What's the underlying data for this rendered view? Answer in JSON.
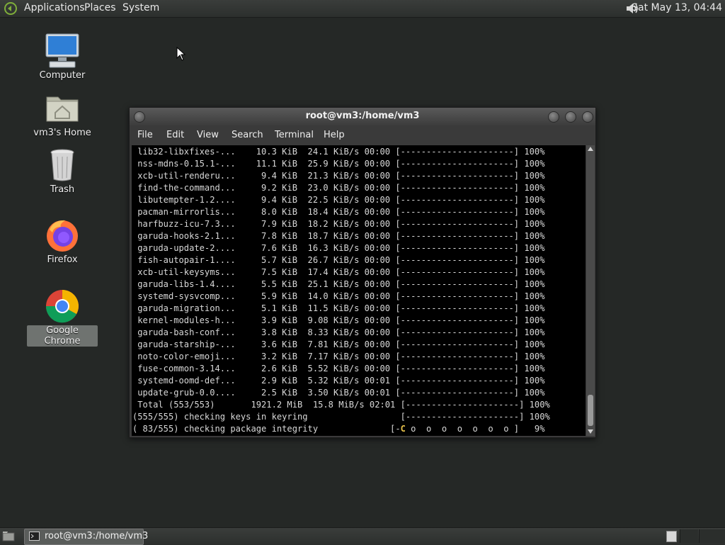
{
  "top_panel": {
    "menus": [
      "Applications",
      "Places",
      "System"
    ],
    "clock": "Sat May 13, 04:44",
    "distro_icon": "garuda-logo-icon",
    "volume_icon": "speaker-icon"
  },
  "desktop_icons": [
    {
      "label": "Computer",
      "icon": "computer-icon"
    },
    {
      "label": "vm3's Home",
      "icon": "home-folder-icon"
    },
    {
      "label": "Trash",
      "icon": "trash-icon"
    },
    {
      "label": "Firefox",
      "icon": "firefox-icon"
    },
    {
      "label": "Google Chrome",
      "icon": "chrome-icon",
      "selected": true
    }
  ],
  "terminal": {
    "title": "root@vm3:/home/vm3",
    "menu": [
      "File",
      "Edit",
      "View",
      "Search",
      "Terminal",
      "Help"
    ],
    "lines": [
      " lib32-libxfixes-...    10.3 KiB  24.1 KiB/s 00:00 [----------------------] 100%",
      " nss-mdns-0.15.1-...    11.1 KiB  25.9 KiB/s 00:00 [----------------------] 100%",
      " xcb-util-renderu...     9.4 KiB  21.3 KiB/s 00:00 [----------------------] 100%",
      " find-the-command...     9.2 KiB  23.0 KiB/s 00:00 [----------------------] 100%",
      " libutempter-1.2....     9.4 KiB  22.5 KiB/s 00:00 [----------------------] 100%",
      " pacman-mirrorlis...     8.0 KiB  18.4 KiB/s 00:00 [----------------------] 100%",
      " harfbuzz-icu-7.3...     7.9 KiB  18.2 KiB/s 00:00 [----------------------] 100%",
      " garuda-hooks-2.1...     7.8 KiB  18.7 KiB/s 00:00 [----------------------] 100%",
      " garuda-update-2....     7.6 KiB  16.3 KiB/s 00:00 [----------------------] 100%",
      " fish-autopair-1....     5.7 KiB  26.7 KiB/s 00:00 [----------------------] 100%",
      " xcb-util-keysyms...     7.5 KiB  17.4 KiB/s 00:00 [----------------------] 100%",
      " garuda-libs-1.4....     5.5 KiB  25.1 KiB/s 00:00 [----------------------] 100%",
      " systemd-sysvcomp...     5.9 KiB  14.0 KiB/s 00:00 [----------------------] 100%",
      " garuda-migration...     5.1 KiB  11.5 KiB/s 00:00 [----------------------] 100%",
      " kernel-modules-h...     3.9 KiB  9.08 KiB/s 00:00 [----------------------] 100%",
      " garuda-bash-conf...     3.8 KiB  8.33 KiB/s 00:00 [----------------------] 100%",
      " garuda-starship-...     3.6 KiB  7.81 KiB/s 00:00 [----------------------] 100%",
      " noto-color-emoji...     3.2 KiB  7.17 KiB/s 00:00 [----------------------] 100%",
      " fuse-common-3.14...     2.6 KiB  5.52 KiB/s 00:00 [----------------------] 100%",
      " systemd-oomd-def...     2.9 KiB  5.32 KiB/s 00:01 [----------------------] 100%",
      " update-grub-0.0....     2.5 KiB  3.50 KiB/s 00:01 [----------------------] 100%",
      " Total (553/553)       1921.2 MiB  15.8 MiB/s 02:01 [----------------------] 100%",
      "(555/555) checking keys in keyring                  [----------------------] 100%"
    ],
    "progress_line": {
      "prefix": "( 83/555) checking package integrity              [-",
      "pacman": "C",
      "suffix": " o  o  o  o  o  o  o ]   9%"
    },
    "progress_percent": 9
  },
  "bottom_panel": {
    "task_label": "root@vm3:/home/vm3",
    "workspaces": 3
  },
  "colors": {
    "desktop_bg": "#252826",
    "terminal_bg": "#000000",
    "terminal_fg": "#d8d8d8",
    "pacman": "#e8c24a"
  }
}
